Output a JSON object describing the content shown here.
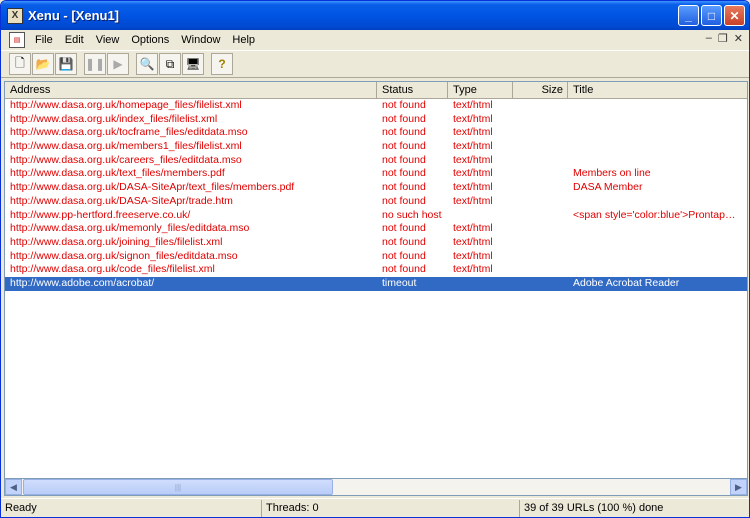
{
  "window": {
    "title": "Xenu - [Xenu1]"
  },
  "menu": {
    "items": [
      "File",
      "Edit",
      "View",
      "Options",
      "Window",
      "Help"
    ]
  },
  "toolbar": {
    "buttons": [
      {
        "name": "new-icon",
        "glyph": "🗋"
      },
      {
        "name": "open-icon",
        "glyph": "📂"
      },
      {
        "name": "save-icon",
        "glyph": "💾"
      },
      {
        "name": "pause-icon",
        "glyph": "❚❚"
      },
      {
        "name": "play-icon",
        "glyph": "▶"
      },
      {
        "name": "find-icon",
        "glyph": "🔍"
      },
      {
        "name": "copy-icon",
        "glyph": "⧉"
      },
      {
        "name": "properties-icon",
        "glyph": "🖥"
      },
      {
        "name": "help-icon",
        "glyph": "?"
      }
    ]
  },
  "list": {
    "columns": [
      "Address",
      "Status",
      "Type",
      "Size",
      "Title"
    ],
    "rows": [
      {
        "address": "http://www.dasa.org.uk/homepage_files/filelist.xml",
        "status": "not found",
        "type": "text/html",
        "size": "",
        "title": ""
      },
      {
        "address": "http://www.dasa.org.uk/index_files/filelist.xml",
        "status": "not found",
        "type": "text/html",
        "size": "",
        "title": ""
      },
      {
        "address": "http://www.dasa.org.uk/tocframe_files/editdata.mso",
        "status": "not found",
        "type": "text/html",
        "size": "",
        "title": ""
      },
      {
        "address": "http://www.dasa.org.uk/members1_files/filelist.xml",
        "status": "not found",
        "type": "text/html",
        "size": "",
        "title": ""
      },
      {
        "address": "http://www.dasa.org.uk/careers_files/editdata.mso",
        "status": "not found",
        "type": "text/html",
        "size": "",
        "title": ""
      },
      {
        "address": "http://www.dasa.org.uk/text_files/members.pdf",
        "status": "not found",
        "type": "text/html",
        "size": "",
        "title": "Members on line"
      },
      {
        "address": "http://www.dasa.org.uk/DASA-SiteApr/text_files/members.pdf",
        "status": "not found",
        "type": "text/html",
        "size": "",
        "title": "DASA Member"
      },
      {
        "address": "http://www.dasa.org.uk/DASA-SiteApr/trade.htm",
        "status": "not found",
        "type": "text/html",
        "size": "",
        "title": ""
      },
      {
        "address": "http://www.pp-hertford.freeserve.co.uk/",
        "status": "no such host",
        "type": "",
        "size": "",
        "title": "<span style='color:blue'>Prontap…"
      },
      {
        "address": "http://www.dasa.org.uk/memonly_files/editdata.mso",
        "status": "not found",
        "type": "text/html",
        "size": "",
        "title": ""
      },
      {
        "address": "http://www.dasa.org.uk/joining_files/filelist.xml",
        "status": "not found",
        "type": "text/html",
        "size": "",
        "title": ""
      },
      {
        "address": "http://www.dasa.org.uk/signon_files/editdata.mso",
        "status": "not found",
        "type": "text/html",
        "size": "",
        "title": ""
      },
      {
        "address": "http://www.dasa.org.uk/code_files/filelist.xml",
        "status": "not found",
        "type": "text/html",
        "size": "",
        "title": ""
      },
      {
        "address": "http://www.adobe.com/acrobat/",
        "status": "timeout",
        "type": "",
        "size": "",
        "title": "Adobe Acrobat Reader",
        "selected": true
      }
    ]
  },
  "status": {
    "ready": "Ready",
    "threads": "Threads: 0",
    "progress": "39 of 39 URLs (100 %) done"
  },
  "colors": {
    "error_text": "#e00000",
    "selection": "#316ac5"
  }
}
